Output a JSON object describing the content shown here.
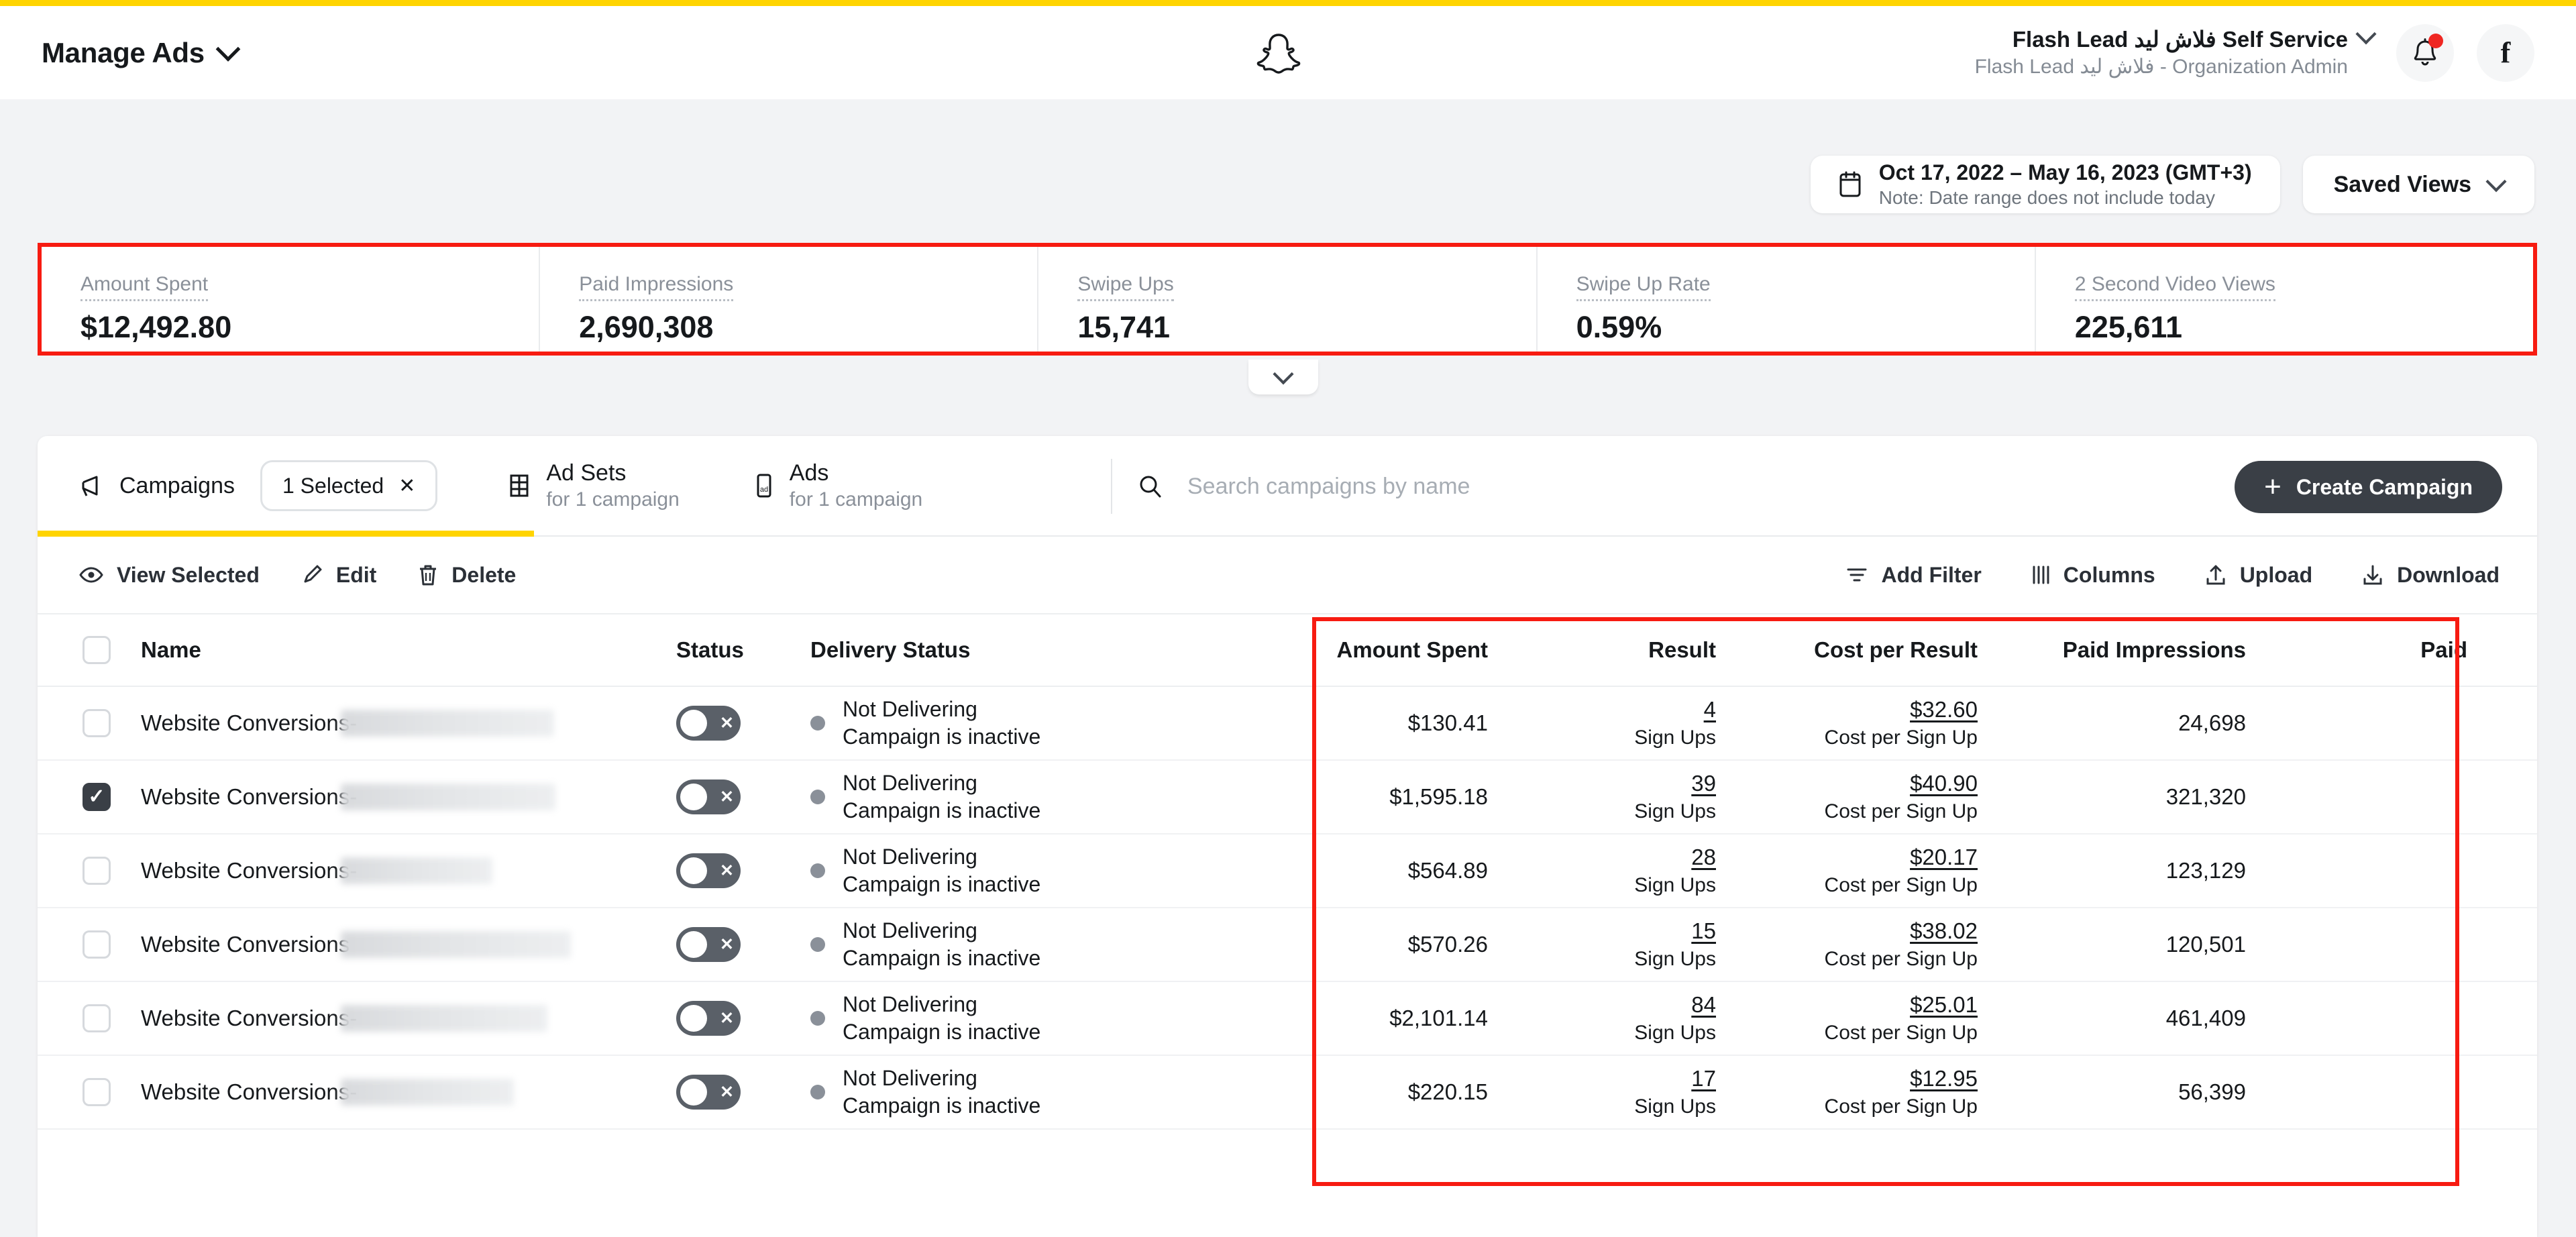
{
  "header": {
    "nav_label": "Manage Ads",
    "logo": "snapchat-ghost-logo",
    "account_name": "Flash Lead فلاش ليد Self Service",
    "account_sub": "Flash Lead فلاش ليد - Organization Admin",
    "facebook_glyph": "f"
  },
  "toolbar": {
    "date_range": "Oct 17, 2022 – May 16, 2023 (GMT+3)",
    "date_note": "Note: Date range does not include today",
    "saved_views": "Saved Views"
  },
  "kpis": [
    {
      "label": "Amount Spent",
      "value": "$12,492.80"
    },
    {
      "label": "Paid Impressions",
      "value": "2,690,308"
    },
    {
      "label": "Swipe Ups",
      "value": "15,741"
    },
    {
      "label": "Swipe Up Rate",
      "value": "0.59%"
    },
    {
      "label": "2 Second Video Views",
      "value": "225,611"
    }
  ],
  "tabs": {
    "campaigns": {
      "label": "Campaigns",
      "chip": "1 Selected",
      "chip_close": "✕"
    },
    "adsets": {
      "label": "Ad Sets",
      "sub": "for 1 campaign"
    },
    "ads": {
      "label": "Ads",
      "sub": "for 1 campaign"
    }
  },
  "search": {
    "placeholder": "Search campaigns by name",
    "value": ""
  },
  "create_button": {
    "label": "Create Campaign",
    "plus": "+"
  },
  "actions": {
    "view_selected": "View Selected",
    "edit": "Edit",
    "delete": "Delete",
    "add_filter": "Add Filter",
    "columns": "Columns",
    "upload": "Upload",
    "download": "Download"
  },
  "table": {
    "headers": {
      "name": "Name",
      "status": "Status",
      "delivery_status": "Delivery Status",
      "amount_spent": "Amount Spent",
      "result": "Result",
      "cost_per_result": "Cost per Result",
      "paid_impressions": "Paid Impressions",
      "paid_partial": "Paid"
    },
    "rows": [
      {
        "selected": false,
        "name": "Website Conversions-",
        "redacted_width": 318,
        "status_toggle": "off",
        "delivery_main": "Not Delivering",
        "delivery_sub": "Campaign is inactive",
        "amount_spent": "$130.41",
        "result": "4",
        "result_sub": "Sign Ups",
        "cost_per_result": "$32.60",
        "cost_sub": "Cost per Sign Up",
        "paid_impressions": "24,698"
      },
      {
        "selected": true,
        "name": "Website Conversions-",
        "redacted_width": 320,
        "status_toggle": "off",
        "delivery_main": "Not Delivering",
        "delivery_sub": "Campaign is inactive",
        "amount_spent": "$1,595.18",
        "result": "39",
        "result_sub": "Sign Ups",
        "cost_per_result": "$40.90",
        "cost_sub": "Cost per Sign Up",
        "paid_impressions": "321,320"
      },
      {
        "selected": false,
        "name": "Website Conversions-",
        "redacted_width": 226,
        "status_toggle": "off",
        "delivery_main": "Not Delivering",
        "delivery_sub": "Campaign is inactive",
        "amount_spent": "$564.89",
        "result": "28",
        "result_sub": "Sign Ups",
        "cost_per_result": "$20.17",
        "cost_sub": "Cost per Sign Up",
        "paid_impressions": "123,129"
      },
      {
        "selected": false,
        "name": "Website Conversions",
        "redacted_width": 343,
        "status_toggle": "off",
        "delivery_main": "Not Delivering",
        "delivery_sub": "Campaign is inactive",
        "amount_spent": "$570.26",
        "result": "15",
        "result_sub": "Sign Ups",
        "cost_per_result": "$38.02",
        "cost_sub": "Cost per Sign Up",
        "paid_impressions": "120,501"
      },
      {
        "selected": false,
        "name": "Website Conversions-",
        "redacted_width": 308,
        "status_toggle": "off",
        "delivery_main": "Not Delivering",
        "delivery_sub": "Campaign is inactive",
        "amount_spent": "$2,101.14",
        "result": "84",
        "result_sub": "Sign Ups",
        "cost_per_result": "$25.01",
        "cost_sub": "Cost per Sign Up",
        "paid_impressions": "461,409"
      },
      {
        "selected": false,
        "name": "Website Conversions-",
        "redacted_width": 258,
        "status_toggle": "off",
        "delivery_main": "Not Delivering",
        "delivery_sub": "Campaign is inactive",
        "amount_spent": "$220.15",
        "result": "17",
        "result_sub": "Sign Ups",
        "cost_per_result": "$12.95",
        "cost_sub": "Cost per Sign Up",
        "paid_impressions": "56,399"
      }
    ]
  },
  "colors": {
    "brand_yellow": "#FFD400",
    "highlight_red": "#f71b11",
    "notification_red": "#ef2722",
    "dark_button": "#3a3f46",
    "muted_text": "#8a9099"
  }
}
